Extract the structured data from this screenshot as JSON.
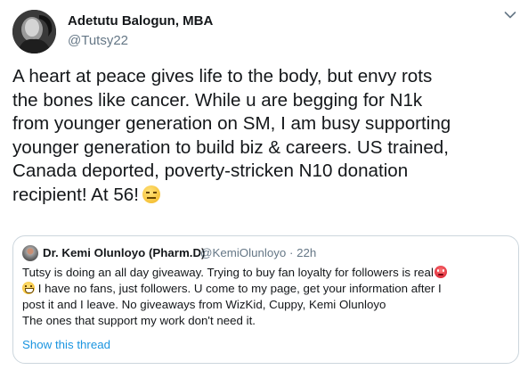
{
  "tweet": {
    "author": {
      "display_name": "Adetutu Balogun, MBA",
      "handle": "@Tutsy22",
      "avatar_icon": "profile-photo-avatar"
    },
    "more_icon": "chevron-down-icon",
    "text_lines": [
      "A heart at peace gives life to the body, but envy rots",
      "the bones like cancer. While u are begging for N1k",
      "from younger generation on SM, I am busy supporting",
      "younger generation to build biz & careers. US trained,",
      "Canada deported, poverty-stricken N10 donation",
      "recipient! At 56!"
    ],
    "text_emoji": "expressionless-face-emoji"
  },
  "quote": {
    "display_name": "Dr. Kemi Olunloyo (Pharm.D)",
    "handle_time": "@KemiOlunloyo · 22h",
    "body_lines": [
      "Tutsy is doing an all day giveaway. Trying to buy fan loyalty for followers is real",
      " I have no fans, just followers. U come to my page, get your information after I",
      "post it and I leave. No giveaways from WizKid, Cuppy, Kemi Olunloyo",
      "The ones that support my work don't need it."
    ],
    "emojis": [
      "angry-face-emoji",
      "grinning-sweat-emoji"
    ],
    "show_thread_label": "Show this thread"
  },
  "colors": {
    "text": "#14171a",
    "secondary": "#657786",
    "link": "#1b95e0",
    "border": "#ccd6dd"
  }
}
